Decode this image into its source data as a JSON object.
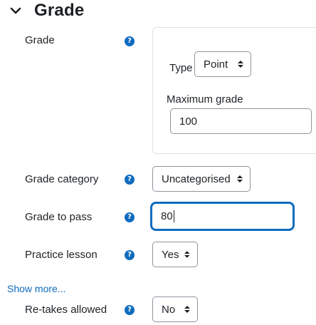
{
  "section": {
    "title": "Grade"
  },
  "grade": {
    "label": "Grade",
    "type_label": "Type",
    "type_value": "Point",
    "max_label": "Maximum grade",
    "max_value": "100"
  },
  "grade_category": {
    "label": "Grade category",
    "value": "Uncategorised"
  },
  "grade_to_pass": {
    "label": "Grade to pass",
    "value": "80"
  },
  "practice_lesson": {
    "label": "Practice lesson",
    "value": "Yes"
  },
  "show_more": {
    "label": "Show more..."
  },
  "retakes": {
    "label": "Re-takes allowed",
    "value": "No"
  },
  "colors": {
    "accent": "#0f6cbf",
    "text": "#1d2125",
    "border": "#8f959e"
  }
}
